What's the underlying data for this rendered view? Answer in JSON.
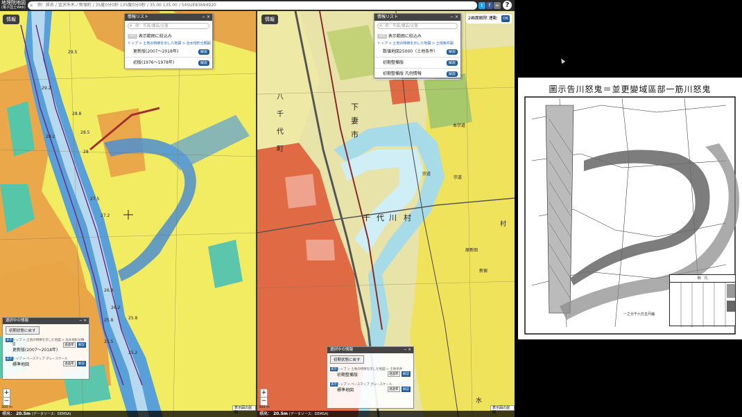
{
  "app": {
    "logo_line1": "地理院地図",
    "logo_line2": "(電子国土Web)",
    "search_text": "例：県名 / 金沢市木ノ新保町 / 35度0分0秒 135度0分0秒 / 35.00 135.00 / 54SUE83694920",
    "help": "?"
  },
  "left_map": {
    "info_button": "情報",
    "info_list": {
      "title": "情報リスト",
      "search_placeholder": "例：写真/標高/災害",
      "toggle_label": "OFF",
      "filter_label": "表示範囲に絞込み",
      "breadcrumb": "トップ > 土地の特徴を示した地図 > 治水地形分類図",
      "items": [
        {
          "label": "更新版(2007〜2018年)",
          "button": "解説"
        },
        {
          "label": "初版(1976〜1978年)",
          "button": "解説"
        }
      ]
    },
    "selected_panel": {
      "title": "選択中の情報",
      "reset": "初期状態に戻す",
      "layers": [
        {
          "path": "トップ > 土地の特徴を示した地図 > 治水地形分類図",
          "name": "更新版(2007〜2018年)",
          "opacity_label": "透過率",
          "help": "解説"
        },
        {
          "path": "トップ > ベースマップ",
          "gray": "グレースケール",
          "name": "標準地図",
          "opacity_label": "透過率",
          "help": "解説"
        }
      ]
    },
    "contour_labels": [
      "29.5",
      "29.2",
      "28.8",
      "28.5",
      "28",
      "28.2",
      "27.5",
      "27.2",
      "26.8",
      "26.2",
      "25.8",
      "25.5",
      "25.2",
      "25.8"
    ],
    "status": "標高：",
    "elevation": "20.5m",
    "elev_source": "(データソース：DEM5A)",
    "legend_btn": "表示図の説明",
    "scale": "300 m"
  },
  "right_map": {
    "info_button": "情報",
    "info_list": {
      "title": "情報リスト",
      "search_placeholder": "例：写真/標高/災害",
      "toggle_label": "OFF",
      "filter_label": "表示範囲に絞込み",
      "breadcrumb": "トップ > 土地の特徴を示した地図 > 土地条件図",
      "items": [
        {
          "label": "数値地図25000（土地条件）",
          "button": "解説"
        },
        {
          "label": "初期整備版",
          "button": "解説"
        },
        {
          "label": "初期整備版 凡例情報",
          "button": "解説"
        }
      ]
    },
    "selected_panel": {
      "title": "選択中の情報",
      "reset": "初期状態に戻す",
      "layers": [
        {
          "path": "トップ > 土地の特徴を示した地図 > 土地条件",
          "name": "初期整備版",
          "opacity_label": "透過率",
          "help": "解説"
        },
        {
          "path": "トップ > ベースマップ",
          "gray": "グレースケール",
          "name": "標準地図",
          "opacity_label": "透過率",
          "help": "解説"
        }
      ]
    },
    "place_labels": [
      "下",
      "妻",
      "市",
      "千",
      "代",
      "川",
      "村",
      "八",
      "千",
      "代",
      "町",
      "本宗道",
      "宗道",
      "宗道",
      "原新田",
      "新宿",
      "村",
      "水"
    ],
    "status": "標高：",
    "elevation": "20.5m",
    "elev_source": "(データソース：DEM5A)",
    "legend_btn": "表示図の説明",
    "scale": "300 m"
  },
  "sync": {
    "label": "2画面解除",
    "mode": "連動",
    "ok": "OK"
  },
  "document": {
    "title": "圖示告川怒鬼＝並更變域區部一筋川怒鬼",
    "legend_title": "例　凡",
    "scale_text": "一之分千六万五尺縮"
  },
  "colors": {
    "river": "#5aa0d8",
    "low_yellow": "#f2ec62",
    "terrace_orange": "#e9a546",
    "teal": "#57c7a8",
    "red_hill": "#e06a43"
  }
}
